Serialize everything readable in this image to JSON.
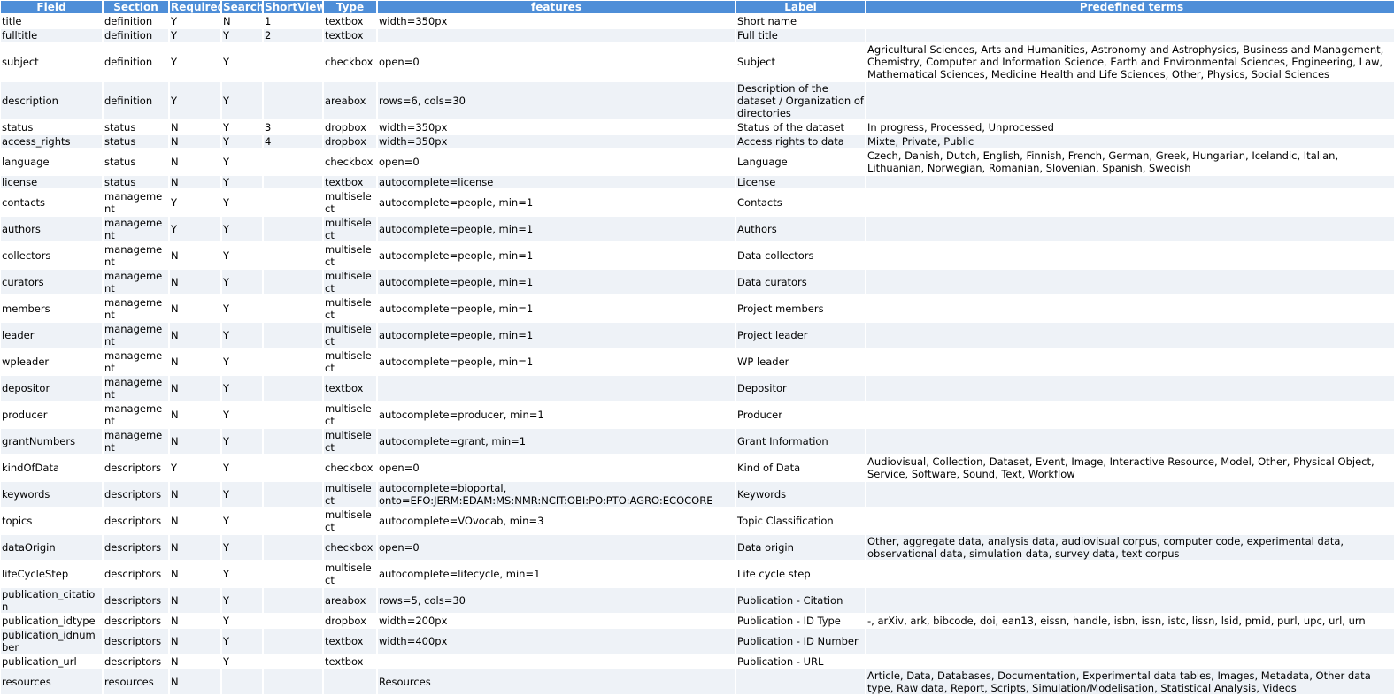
{
  "headers": [
    "Field",
    "Section",
    "Required",
    "Search",
    "ShortView",
    "Type",
    "features",
    "Label",
    "Predefined terms"
  ],
  "rows": [
    {
      "field": "title",
      "section": "definition",
      "required": "Y",
      "search": "N",
      "shortview": "1",
      "type": "textbox",
      "features": "width=350px",
      "label": "Short name",
      "terms": ""
    },
    {
      "field": "fulltitle",
      "section": "definition",
      "required": "Y",
      "search": "Y",
      "shortview": "2",
      "type": "textbox",
      "features": "",
      "label": "Full title",
      "terms": ""
    },
    {
      "field": "subject",
      "section": "definition",
      "required": "Y",
      "search": "Y",
      "shortview": "",
      "type": "checkbox",
      "features": "open=0",
      "label": "Subject",
      "terms": "Agricultural Sciences, Arts and Humanities, Astronomy and Astrophysics, Business and Management, Chemistry, Computer and Information Science, Earth and Environmental Sciences, Engineering, Law, Mathematical Sciences, Medicine Health and Life Sciences, Other, Physics, Social Sciences"
    },
    {
      "field": "description",
      "section": "definition",
      "required": "Y",
      "search": "Y",
      "shortview": "",
      "type": "areabox",
      "features": "rows=6, cols=30",
      "label": "Description of the dataset / Organization of directories",
      "terms": ""
    },
    {
      "field": "status",
      "section": "status",
      "required": "N",
      "search": "Y",
      "shortview": "3",
      "type": "dropbox",
      "features": "width=350px",
      "label": "Status of the dataset",
      "terms": "In progress, Processed, Unprocessed"
    },
    {
      "field": "access_rights",
      "section": "status",
      "required": "N",
      "search": "Y",
      "shortview": "4",
      "type": "dropbox",
      "features": "width=350px",
      "label": "Access rights to data",
      "terms": "Mixte, Private, Public"
    },
    {
      "field": "language",
      "section": "status",
      "required": "N",
      "search": "Y",
      "shortview": "",
      "type": "checkbox",
      "features": "open=0",
      "label": "Language",
      "terms": "Czech, Danish, Dutch, English, Finnish, French, German, Greek, Hungarian, Icelandic, Italian, Lithuanian, Norwegian, Romanian, Slovenian, Spanish, Swedish"
    },
    {
      "field": "license",
      "section": "status",
      "required": "N",
      "search": "Y",
      "shortview": "",
      "type": "textbox",
      "features": "autocomplete=license",
      "label": "License",
      "terms": ""
    },
    {
      "field": "contacts",
      "section": "management",
      "required": "Y",
      "search": "Y",
      "shortview": "",
      "type": "multiselect",
      "features": "autocomplete=people, min=1",
      "label": "Contacts",
      "terms": ""
    },
    {
      "field": "authors",
      "section": "management",
      "required": "Y",
      "search": "Y",
      "shortview": "",
      "type": "multiselect",
      "features": "autocomplete=people, min=1",
      "label": "Authors",
      "terms": ""
    },
    {
      "field": "collectors",
      "section": "management",
      "required": "N",
      "search": "Y",
      "shortview": "",
      "type": "multiselect",
      "features": "autocomplete=people, min=1",
      "label": "Data collectors",
      "terms": ""
    },
    {
      "field": "curators",
      "section": "management",
      "required": "N",
      "search": "Y",
      "shortview": "",
      "type": "multiselect",
      "features": "autocomplete=people, min=1",
      "label": "Data curators",
      "terms": ""
    },
    {
      "field": "members",
      "section": "management",
      "required": "N",
      "search": "Y",
      "shortview": "",
      "type": "multiselect",
      "features": "autocomplete=people, min=1",
      "label": "Project members",
      "terms": ""
    },
    {
      "field": "leader",
      "section": "management",
      "required": "N",
      "search": "Y",
      "shortview": "",
      "type": "multiselect",
      "features": "autocomplete=people, min=1",
      "label": "Project leader",
      "terms": ""
    },
    {
      "field": "wpleader",
      "section": "management",
      "required": "N",
      "search": "Y",
      "shortview": "",
      "type": "multiselect",
      "features": "autocomplete=people, min=1",
      "label": "WP leader",
      "terms": ""
    },
    {
      "field": "depositor",
      "section": "management",
      "required": "N",
      "search": "Y",
      "shortview": "",
      "type": "textbox",
      "features": "",
      "label": "Depositor",
      "terms": ""
    },
    {
      "field": "producer",
      "section": "management",
      "required": "N",
      "search": "Y",
      "shortview": "",
      "type": "multiselect",
      "features": "autocomplete=producer, min=1",
      "label": "Producer",
      "terms": ""
    },
    {
      "field": "grantNumbers",
      "section": "management",
      "required": "N",
      "search": "Y",
      "shortview": "",
      "type": "multiselect",
      "features": "autocomplete=grant, min=1",
      "label": "Grant Information",
      "terms": ""
    },
    {
      "field": "kindOfData",
      "section": "descriptors",
      "required": "Y",
      "search": "Y",
      "shortview": "",
      "type": "checkbox",
      "features": "open=0",
      "label": "Kind of Data",
      "terms": "Audiovisual, Collection, Dataset, Event, Image, Interactive Resource, Model, Other, Physical Object, Service, Software, Sound, Text, Workflow"
    },
    {
      "field": "keywords",
      "section": "descriptors",
      "required": "N",
      "search": "Y",
      "shortview": "",
      "type": "multiselect",
      "features": "autocomplete=bioportal, onto=EFO:JERM:EDAM:MS:NMR:NCIT:OBI:PO:PTO:AGRO:ECOCORE",
      "label": "Keywords",
      "terms": ""
    },
    {
      "field": "topics",
      "section": "descriptors",
      "required": "N",
      "search": "Y",
      "shortview": "",
      "type": "multiselect",
      "features": "autocomplete=VOvocab, min=3",
      "label": "Topic Classification",
      "terms": ""
    },
    {
      "field": "dataOrigin",
      "section": "descriptors",
      "required": "N",
      "search": "Y",
      "shortview": "",
      "type": "checkbox",
      "features": "open=0",
      "label": "Data origin",
      "terms": "Other, aggregate data, analysis data, audiovisual corpus, computer code, experimental data, observational data, simulation data, survey data, text corpus"
    },
    {
      "field": "lifeCycleStep",
      "section": "descriptors",
      "required": "N",
      "search": "Y",
      "shortview": "",
      "type": "multiselect",
      "features": "autocomplete=lifecycle, min=1",
      "label": "Life cycle step",
      "terms": ""
    },
    {
      "field": "publication_citation",
      "section": "descriptors",
      "required": "N",
      "search": "Y",
      "shortview": "",
      "type": "areabox",
      "features": "rows=5, cols=30",
      "label": "Publication - Citation",
      "terms": ""
    },
    {
      "field": "publication_idtype",
      "section": "descriptors",
      "required": "N",
      "search": "Y",
      "shortview": "",
      "type": "dropbox",
      "features": "width=200px",
      "label": "Publication - ID Type",
      "terms": "-, arXiv, ark, bibcode, doi, ean13, eissn, handle, isbn, issn, istc, lissn, lsid, pmid, purl, upc, url, urn"
    },
    {
      "field": "publication_idnumber",
      "section": "descriptors",
      "required": "N",
      "search": "Y",
      "shortview": "",
      "type": "textbox",
      "features": "width=400px",
      "label": "Publication - ID Number",
      "terms": ""
    },
    {
      "field": "publication_url",
      "section": "descriptors",
      "required": "N",
      "search": "Y",
      "shortview": "",
      "type": "textbox",
      "features": "",
      "label": "Publication - URL",
      "terms": ""
    },
    {
      "field": "resources",
      "section": "resources",
      "required": "N",
      "search": "",
      "shortview": "",
      "type": "",
      "features": "Resources",
      "label": "",
      "terms": "Article, Data, Databases, Documentation, Experimental data tables, Images, Metadata, Other data type, Raw data, Report, Scripts, Simulation/Modelisation, Statistical Analysis, Videos"
    }
  ]
}
